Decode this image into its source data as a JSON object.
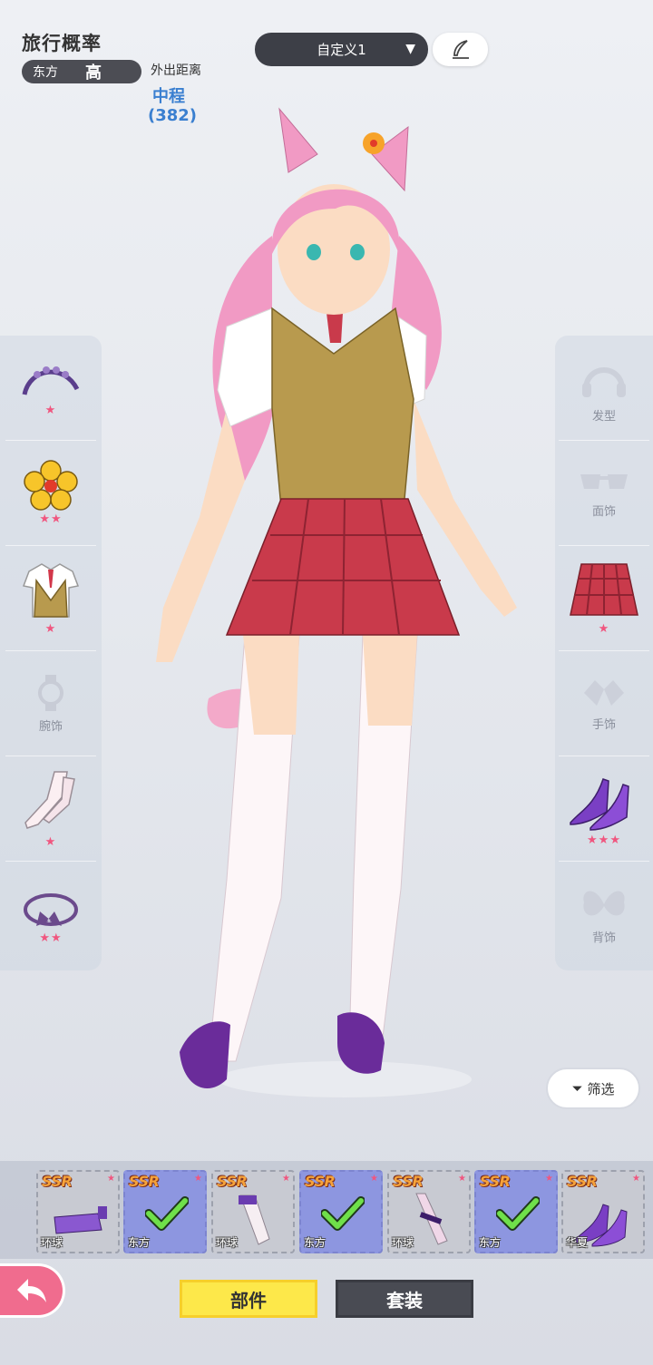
{
  "info": {
    "title": "旅行概率",
    "region": "东方",
    "level": "高",
    "distance_label": "外出距离",
    "distance_value": "中程",
    "distance_number": "(382)"
  },
  "preset": {
    "label": "自定义1"
  },
  "left_slots": [
    {
      "name": "headband",
      "label": "",
      "stars": "★"
    },
    {
      "name": "flower-hairpin",
      "label": "",
      "stars": "★★"
    },
    {
      "name": "school-uniform",
      "label": "",
      "stars": "★"
    },
    {
      "name": "wrist",
      "label": "腕饰",
      "stars": ""
    },
    {
      "name": "stockings",
      "label": "",
      "stars": "★"
    },
    {
      "name": "ribbon",
      "label": "",
      "stars": "★★"
    }
  ],
  "right_slots": [
    {
      "name": "hair",
      "label": "发型",
      "stars": ""
    },
    {
      "name": "face",
      "label": "面饰",
      "stars": ""
    },
    {
      "name": "skirt",
      "label": "",
      "stars": "★"
    },
    {
      "name": "hand",
      "label": "手饰",
      "stars": ""
    },
    {
      "name": "heels",
      "label": "",
      "stars": "★★★"
    },
    {
      "name": "back",
      "label": "背饰",
      "stars": ""
    }
  ],
  "filter": {
    "label": "筛选"
  },
  "items": [
    {
      "rarity": "SSR",
      "origin": "环球",
      "equipped": false
    },
    {
      "rarity": "SSR",
      "origin": "东方",
      "equipped": true
    },
    {
      "rarity": "SSR",
      "origin": "环球",
      "equipped": false
    },
    {
      "rarity": "SSR",
      "origin": "东方",
      "equipped": true
    },
    {
      "rarity": "SSR",
      "origin": "环球",
      "equipped": false
    },
    {
      "rarity": "SSR",
      "origin": "东方",
      "equipped": true
    },
    {
      "rarity": "SSR",
      "origin": "华夏",
      "equipped": false
    }
  ],
  "tabs": {
    "parts": "部件",
    "sets": "套装"
  },
  "colors": {
    "accent_yellow": "#fde84a",
    "star_pink": "#f0567f",
    "distance_blue": "#3a7fd0",
    "equipped_blue": "#8d96e0"
  }
}
